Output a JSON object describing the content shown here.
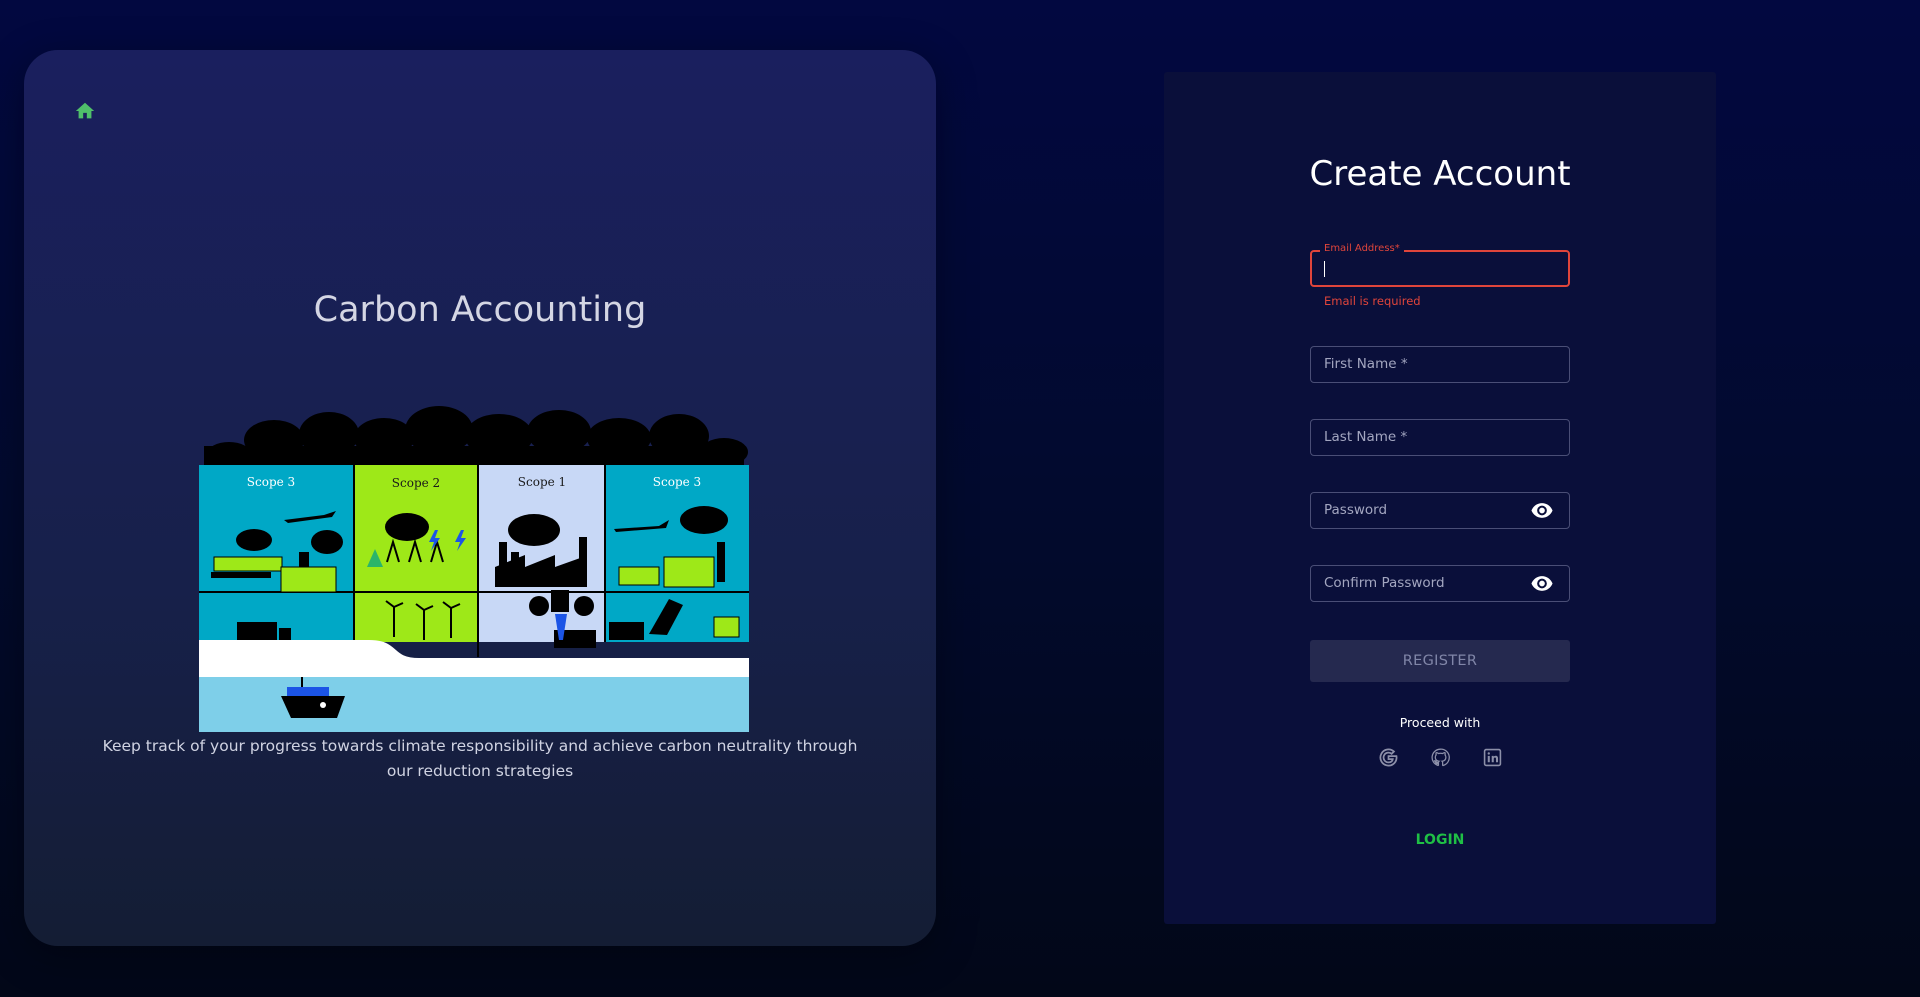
{
  "left": {
    "title": "Carbon Accounting",
    "tagline": "Keep track of your progress towards climate responsibility and achieve carbon neutrality through our reduction strategies",
    "home_icon": "home-icon",
    "illustration": {
      "panels": [
        "Scope 3",
        "Scope 2",
        "Scope 1",
        "Scope 3"
      ],
      "colors": {
        "scope3": "#00a8c6",
        "scope2": "#9ee818",
        "scope1": "#c8d8f6",
        "sea": "#7ecfe9"
      }
    }
  },
  "form": {
    "title": "Create Account",
    "fields": {
      "email": {
        "label": "Email Address",
        "required_mark": "*",
        "value": "",
        "error": "Email is required"
      },
      "first_name": {
        "placeholder": "First Name *",
        "value": ""
      },
      "last_name": {
        "placeholder": "Last Name *",
        "value": ""
      },
      "password": {
        "placeholder": "Password",
        "value": "",
        "icon": "eye-icon"
      },
      "confirm_password": {
        "placeholder": "Confirm Password",
        "value": "",
        "icon": "eye-icon"
      }
    },
    "register_label": "REGISTER",
    "proceed_label": "Proceed with",
    "social": [
      "google-icon",
      "github-icon",
      "linkedin-icon"
    ],
    "login_label": "LOGIN"
  },
  "colors": {
    "error": "#e0453b",
    "accent_green": "#1fbf45",
    "home_icon": "#4fbf6a"
  }
}
